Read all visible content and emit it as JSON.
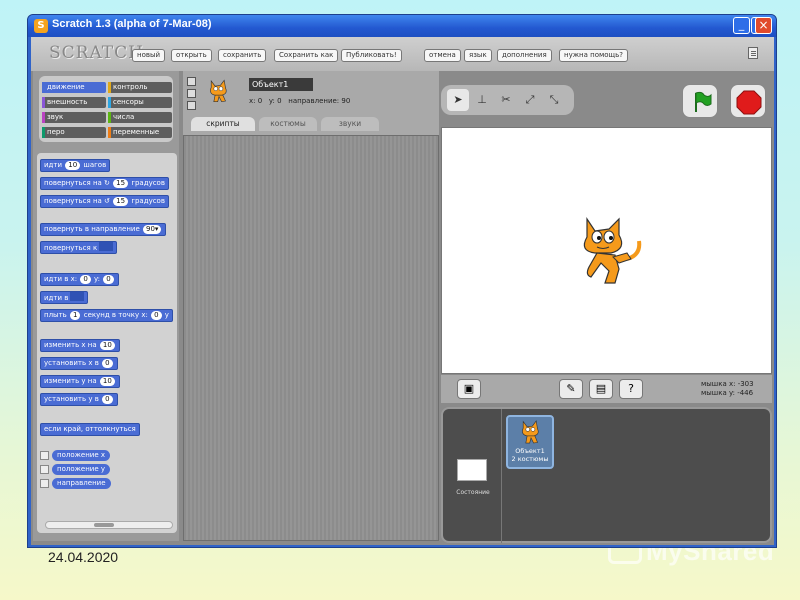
{
  "slide": {
    "date": "24.04.2020",
    "watermark": "MyShared"
  },
  "window": {
    "title": "Scratch 1.3 (alpha of 7-Mar-08)",
    "minimize": "_",
    "maximize": "□",
    "close": "×"
  },
  "topbar": {
    "logo": "SCRATCH",
    "menu": [
      "новый",
      "открыть",
      "сохранить",
      "Сохранить как",
      "Публиковать!",
      "отмена",
      "язык",
      "дополнения",
      "нужна помощь?"
    ]
  },
  "categories": [
    {
      "label": "движение",
      "color": "#4a6cd4"
    },
    {
      "label": "контроль",
      "color": "#e1a91a"
    },
    {
      "label": "внешность",
      "color": "#8a55d7"
    },
    {
      "label": "сенсоры",
      "color": "#2ca5e2"
    },
    {
      "label": "звук",
      "color": "#bb42c3"
    },
    {
      "label": "числа",
      "color": "#5cb712"
    },
    {
      "label": "перо",
      "color": "#0e9a6c"
    },
    {
      "label": "переменные",
      "color": "#ee7d16"
    }
  ],
  "blocks": {
    "move_pre": "идти",
    "move_num": "10",
    "move_post": "шагов",
    "turn_right_pre": "повернуться на",
    "turn_right_icon": "↻",
    "turn_right_num": "15",
    "turn_right_post": "градусов",
    "turn_left_pre": "повернуться на",
    "turn_left_icon": "↺",
    "turn_left_num": "15",
    "turn_left_post": "градусов",
    "point_dir_pre": "повернуть в направление",
    "point_dir_num": "90▾",
    "point_to": "повернуться к",
    "goto_xy_pre": "идти в x:",
    "goto_xy_x": "0",
    "goto_xy_mid": "y:",
    "goto_xy_y": "0",
    "goto": "идти в",
    "glide_pre": "плыть",
    "glide_num": "1",
    "glide_mid": "секунд в точку x:",
    "glide_x": "0",
    "glide_end": "y",
    "change_x_pre": "изменить x на",
    "change_x_num": "10",
    "set_x_pre": "установить x в",
    "set_x_num": "0",
    "change_y_pre": "изменить y на",
    "change_y_num": "10",
    "set_y_pre": "установить y в",
    "set_y_num": "0",
    "bounce": "если край, оттолкнуться",
    "rep_x": "положение x",
    "rep_y": "положение y",
    "rep_dir": "направление"
  },
  "sprite": {
    "name": "Объект1",
    "x_label": "x:",
    "x": "0",
    "y_label": "y:",
    "y": "0",
    "dir_label": "направление:",
    "dir": "90"
  },
  "tabs": [
    "скрипты",
    "костюмы",
    "звуки"
  ],
  "mouse": {
    "x_label": "мышка x:",
    "x": "-303",
    "y_label": "мышка y:",
    "y": "-446"
  },
  "sprite_list": {
    "stage_label": "Состояние",
    "sprite_name": "Объект1",
    "sprite_costumes": "2 костюмы"
  },
  "colors": {
    "motion": "#4a6cd4",
    "flag": "#22a022",
    "stop": "#e01b1b",
    "cat": "#f59a1b"
  }
}
